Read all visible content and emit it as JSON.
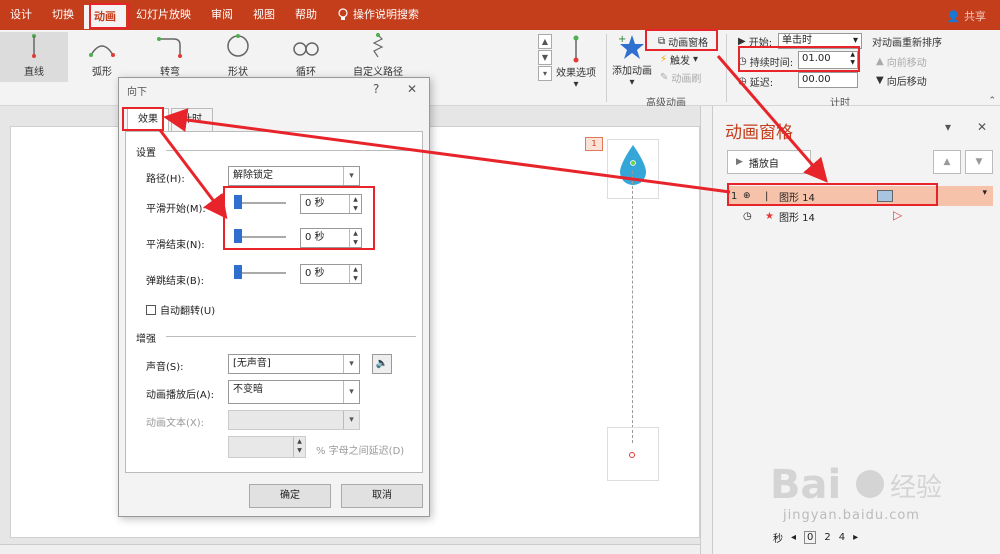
{
  "ribbon_tabs": [
    "设计",
    "切换",
    "动画",
    "幻灯片放映",
    "审阅",
    "视图",
    "帮助",
    "操作说明搜索"
  ],
  "share": "共享",
  "paths": [
    "直线",
    "弧形",
    "转弯",
    "形状",
    "循环",
    "自定义路径"
  ],
  "effect_options": "效果选项",
  "add_animation": "添加动画",
  "anim_pane_btn": "动画窗格",
  "trigger": "触发",
  "anim_painter": "动画刷",
  "adv_group": "高级动画",
  "start_label": "开始:",
  "start_value": "单击时",
  "duration_label": "持续时间:",
  "duration_value": "01.00",
  "delay_label": "延迟:",
  "delay_value": "00.00",
  "reorder": "对动画重新排序",
  "move_earlier": "向前移动",
  "move_later": "向后移动",
  "timing_group": "计时",
  "slide_badge": "1",
  "pane": {
    "title": "动画窗格",
    "play": "播放自",
    "rows": [
      {
        "num": "1",
        "name": "图形 14"
      },
      {
        "num": "",
        "name": "图形 14"
      }
    ],
    "time_unit": "秒",
    "ticks": [
      "0",
      "2",
      "4"
    ]
  },
  "dialog": {
    "title": "向下",
    "help": "?",
    "close": "✕",
    "tab_effect": "效果",
    "tab_timing": "计时",
    "settings": "设置",
    "path_label": "路径(H):",
    "path_value": "解除锁定",
    "smooth_start": "平滑开始(M):",
    "smooth_start_val": "0 秒",
    "smooth_end": "平滑结束(N):",
    "smooth_end_val": "0 秒",
    "bounce_end": "弹跳结束(B):",
    "bounce_end_val": "0 秒",
    "auto_reverse": "自动翻转(U)",
    "enhance": "增强",
    "sound_label": "声音(S):",
    "sound_value": "[无声音]",
    "after_label": "动画播放后(A):",
    "after_value": "不变暗",
    "text_label": "动画文本(X):",
    "delay_text": "% 字母之间延迟(D)",
    "ok": "确定",
    "cancel": "取消"
  },
  "watermark": "jingyan.baidu.com",
  "colors": {
    "accent": "#c43e1c",
    "highlight": "#e8242b",
    "thumb": "#2f6fd0",
    "selected_row": "#f6c3aa"
  }
}
